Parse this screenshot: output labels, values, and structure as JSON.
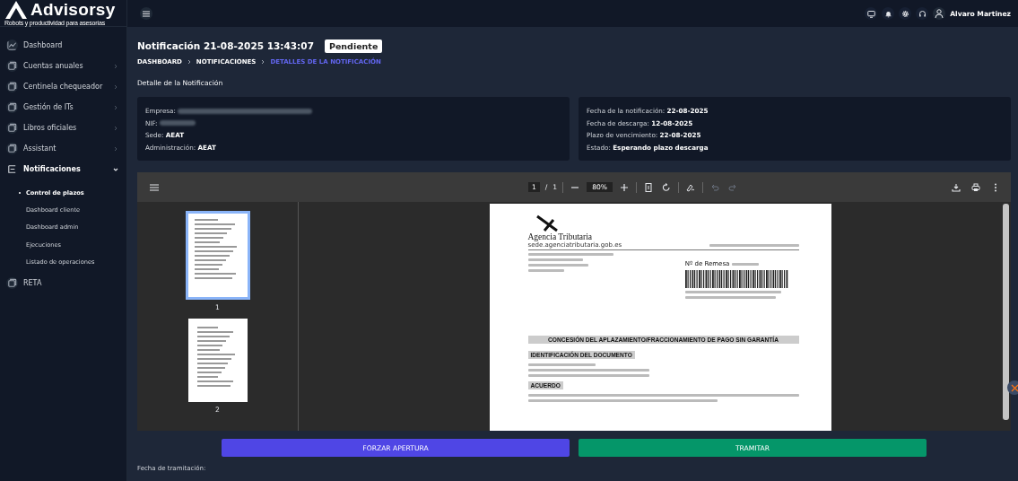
{
  "brand": {
    "name": "Advisorsy",
    "tagline": "Robots y productividad para asesorías"
  },
  "sidebar": {
    "items": [
      {
        "label": "Dashboard",
        "kind": "link",
        "expanded": false
      },
      {
        "label": "Cuentas anuales",
        "kind": "menu",
        "expanded": false
      },
      {
        "label": "Centinela chequeador",
        "kind": "menu",
        "expanded": false
      },
      {
        "label": "Gestión de ITs",
        "kind": "menu",
        "expanded": false
      },
      {
        "label": "Libros oficiales",
        "kind": "menu",
        "expanded": false
      },
      {
        "label": "Assistant",
        "kind": "menu",
        "expanded": false
      },
      {
        "label": "Notificaciones",
        "kind": "menu",
        "expanded": true,
        "children": [
          {
            "label": "Control de plazos",
            "selected": true
          },
          {
            "label": "Dashboard cliente",
            "selected": false
          },
          {
            "label": "Dashboard admin",
            "selected": false
          },
          {
            "label": "Ejecuciones",
            "selected": false
          },
          {
            "label": "Listado de operaciones",
            "selected": false
          }
        ]
      },
      {
        "label": "RETA",
        "kind": "link",
        "expanded": false
      }
    ]
  },
  "topbar": {
    "user": "Alvaro Martinez"
  },
  "page": {
    "title": "Notificación 21-08-2025 13:43:07",
    "status": "Pendiente",
    "breadcrumb": [
      {
        "label": "DASHBOARD",
        "selected": false
      },
      {
        "label": "NOTIFICACIONES",
        "selected": false
      },
      {
        "label": "DETALLES DE LA NOTIFICACIÓN",
        "selected": true
      }
    ],
    "section_title": "Detalle de la Notificación"
  },
  "cards": [
    [
      {
        "label": "Empresa:",
        "kind": "redacted"
      },
      {
        "label": "NIF:",
        "kind": "redacted"
      },
      {
        "label": "Sede:",
        "value": "AEAT",
        "kind": "text"
      },
      {
        "label": "Administración:",
        "value": "AEAT",
        "kind": "text"
      }
    ],
    [
      {
        "label": "Fecha de la notificación:",
        "value": "22-08-2025",
        "kind": "text"
      },
      {
        "label": "Fecha de descarga:",
        "value": "12-08-2025",
        "kind": "text"
      },
      {
        "label": "Plazo de vencimiento:",
        "value": "22-08-2025",
        "kind": "text"
      },
      {
        "label": "Estado:",
        "value": "Esperando plazo descarga",
        "kind": "text"
      }
    ]
  ],
  "viewer": {
    "page_input": "1",
    "page_sep": "/",
    "page_total": "1",
    "zoom": "80%",
    "thumbnails": [
      {
        "label": "1",
        "selected": true
      },
      {
        "label": "2",
        "selected": false
      }
    ],
    "document": {
      "agency": "Agencia Tributaria",
      "site": "sede.agenciatributaria.gob.es",
      "remesa": "Nº de Remesa",
      "heading": "CONCESIÓN DEL APLAZAMIENTO/FRACCIONAMIENTO DE PAGO SIN GARANTÍA",
      "section_1": "IDENTIFICACIÓN DEL DOCUMENTO",
      "section_2": "ACUERDO"
    }
  },
  "buttons": [
    {
      "label": "FORZAR APERTURA",
      "kind": "primary"
    },
    {
      "label": "TRAMITAR",
      "kind": "success"
    }
  ],
  "footer_label": "Fecha de tramitación:"
}
